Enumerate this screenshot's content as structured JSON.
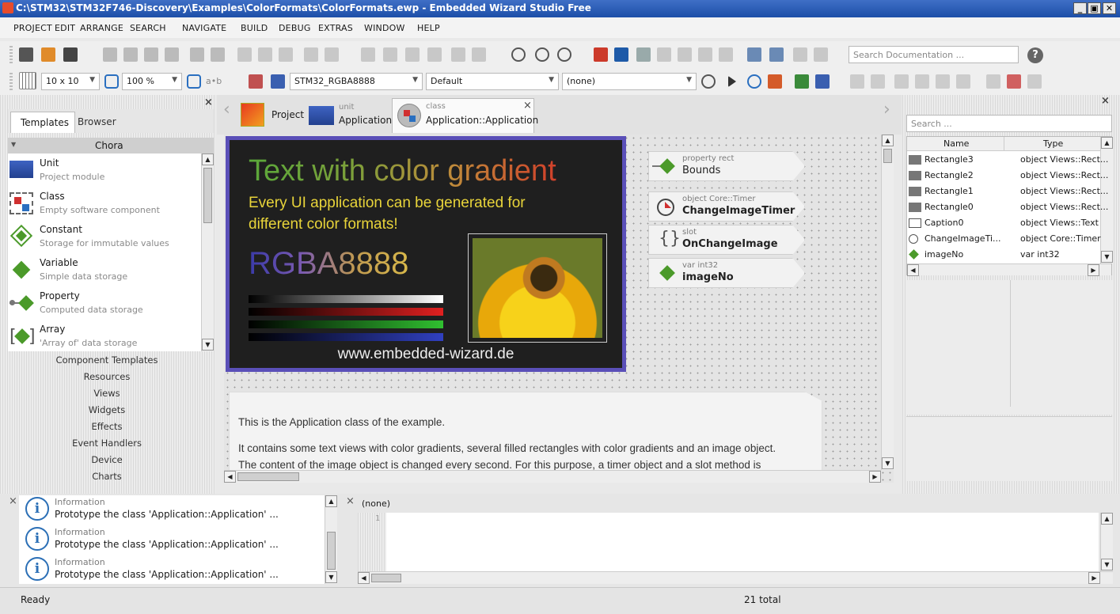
{
  "window": {
    "title": "C:\\STM32\\STM32F746-Discovery\\Examples\\ColorFormats\\ColorFormats.ewp - Embedded Wizard Studio Free"
  },
  "menu": [
    "PROJECT",
    "EDIT",
    "ARRANGE",
    "SEARCH",
    "NAVIGATE",
    "BUILD",
    "DEBUG",
    "EXTRAS",
    "WINDOW",
    "HELP"
  ],
  "toolbar": {
    "search_placeholder": "Search Documentation ...",
    "grid": "10 x 10",
    "zoom": "100 %",
    "ab_label": "a•b",
    "profile": "STM32_RGBA8888",
    "style": "Default",
    "variant": "(none)"
  },
  "left_panel": {
    "tabs": [
      "Templates",
      "Browser"
    ],
    "group": "Chora",
    "items": [
      {
        "name": "Unit",
        "desc": "Project module"
      },
      {
        "name": "Class",
        "desc": "Empty software component"
      },
      {
        "name": "Constant",
        "desc": "Storage for immutable values"
      },
      {
        "name": "Variable",
        "desc": "Simple data storage"
      },
      {
        "name": "Property",
        "desc": "Computed data storage"
      },
      {
        "name": "Array",
        "desc": "'Array of' data storage"
      }
    ],
    "categories": [
      "Component Templates",
      "Resources",
      "Views",
      "Widgets",
      "Effects",
      "Event Handlers",
      "Device",
      "Charts"
    ]
  },
  "editor_tabs": [
    {
      "kind": "",
      "label": "Project"
    },
    {
      "kind": "unit",
      "label": "Application"
    },
    {
      "kind": "class",
      "label": "Application::Application"
    }
  ],
  "canvas": {
    "headline": "Text with color gradient",
    "subline1": "Every UI application can be generated for",
    "subline2": "different color formats!",
    "format": "RGBA8888",
    "url": "www.embedded-wizard.de",
    "members": [
      {
        "kind": "property rect",
        "name": "Bounds"
      },
      {
        "kind": "object Core::Timer",
        "name": "ChangeImageTimer"
      },
      {
        "kind": "slot",
        "name": "OnChangeImage"
      },
      {
        "kind": "var int32",
        "name": "imageNo"
      }
    ],
    "note_lines": [
      "This is the Application class of the example.",
      "It contains some text views with color gradients, several filled rectangles with color gradients and an image object.",
      "The content of the image object is changed every second. For this purpose, a timer object and a slot method is"
    ]
  },
  "right_panel": {
    "search_placeholder": "Search ...",
    "columns": [
      "Name",
      "Type"
    ],
    "rows": [
      {
        "name": "Rectangle3",
        "type": "object Views::Rect..."
      },
      {
        "name": "Rectangle2",
        "type": "object Views::Rect..."
      },
      {
        "name": "Rectangle1",
        "type": "object Views::Rect..."
      },
      {
        "name": "Rectangle0",
        "type": "object Views::Rect..."
      },
      {
        "name": "Caption0",
        "type": "object Views::Text"
      },
      {
        "name": "ChangeImageTi...",
        "type": "object Core::Timer"
      },
      {
        "name": "imageNo",
        "type": "var int32"
      }
    ]
  },
  "log": [
    {
      "level": "Information",
      "msg": "Prototype the class 'Application::Application' ..."
    },
    {
      "level": "Information",
      "msg": "Prototype the class 'Application::Application' ..."
    },
    {
      "level": "Information",
      "msg": "Prototype the class 'Application::Application' ..."
    }
  ],
  "code_editor": {
    "title": "(none)",
    "line": "1"
  },
  "status": {
    "left": "Ready",
    "center": "21 total"
  }
}
